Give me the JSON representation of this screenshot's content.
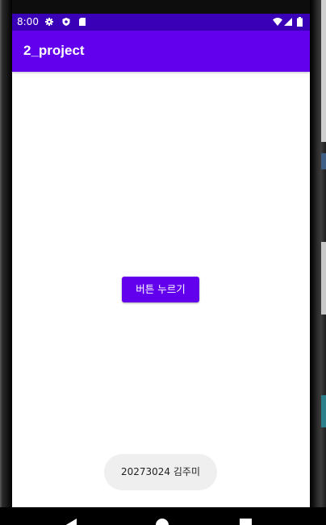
{
  "status_bar": {
    "time": "8:00",
    "icons": [
      "settings-gear-icon",
      "shield-icon",
      "sd-card-icon",
      "wifi-icon",
      "cell-signal-icon",
      "battery-icon"
    ]
  },
  "app_bar": {
    "title": "2_project"
  },
  "main": {
    "button_label": "버튼 누르기"
  },
  "toast": {
    "message": "20273024 김주미"
  },
  "nav_bar": {
    "icons": [
      "back-icon",
      "home-icon",
      "recents-icon"
    ]
  },
  "colors": {
    "status_bar": "#3a00b7",
    "primary": "#6200ee",
    "toast_bg": "#efefef",
    "screen_bg": "#ffffff"
  }
}
